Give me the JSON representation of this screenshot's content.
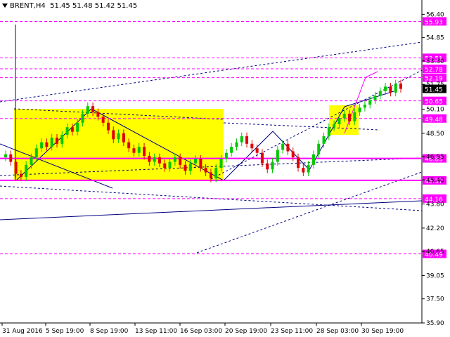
{
  "header": {
    "symbol": "BRENT,H4",
    "ohlc": "51.45 51.48 51.42 51.45"
  },
  "colors": {
    "candle_up": "#00c800",
    "candle_down": "#e00000",
    "magenta": "#ff00ff",
    "blue": "#000080",
    "yellow_box": "#ffff00",
    "price_tag": "#000000"
  },
  "chart_data": {
    "type": "candlestick",
    "ylim": [
      35.9,
      57.35
    ],
    "y_ticks": [
      "56.40",
      "54.85",
      "53.30",
      "51.75",
      "50.10",
      "48.50",
      "46.95",
      "45.40",
      "43.80",
      "42.20",
      "40.65",
      "39.05",
      "37.50",
      "35.90"
    ],
    "x_ticks": [
      "31 Aug 2016",
      "5 Sep 19:00",
      "8 Sep 19:00",
      "13 Sep 11:00",
      "16 Sep 03:00",
      "20 Sep 19:00",
      "23 Sep 11:00",
      "28 Sep 03:00",
      "30 Sep 19:00"
    ],
    "levels": [
      {
        "value": 55.93,
        "label": "55.93",
        "color": "#ff00ff"
      },
      {
        "value": 53.51,
        "label": "53.51",
        "color": "#ff00ff"
      },
      {
        "value": 52.78,
        "label": "52.78",
        "color": "#ff00ff"
      },
      {
        "value": 52.19,
        "label": "52.19",
        "color": "#ff00ff"
      },
      {
        "value": 50.65,
        "label": "50.65",
        "color": "#ff00ff"
      },
      {
        "value": 49.48,
        "label": "49.48",
        "color": "#ff00ff"
      },
      {
        "value": 46.83,
        "label": "46.83",
        "color": "#ff00ff"
      },
      {
        "value": 45.37,
        "label": "45.37",
        "color": "#ff00ff"
      },
      {
        "value": 44.16,
        "label": "44.16",
        "color": "#ff00ff"
      },
      {
        "value": 40.49,
        "label": "40.49",
        "color": "#ff00ff"
      }
    ],
    "current_price": {
      "value": 51.45,
      "label": "51.45"
    },
    "closes": [
      47.1,
      46.6,
      45.8,
      45.6,
      46.4,
      46.9,
      47.5,
      47.9,
      47.6,
      48.2,
      47.8,
      48.4,
      48.9,
      48.6,
      49.2,
      49.8,
      50.3,
      49.9,
      49.6,
      49.2,
      48.7,
      48.1,
      48.5,
      47.9,
      47.5,
      47.2,
      47.6,
      47.0,
      46.6,
      46.9,
      46.5,
      46.2,
      46.6,
      46.9,
      46.4,
      46.0,
      46.5,
      46.8,
      46.2,
      45.9,
      45.5,
      46.2,
      46.8,
      47.2,
      47.6,
      47.9,
      48.3,
      47.8,
      47.5,
      47.2,
      46.5,
      46.1,
      46.6,
      47.4,
      47.8,
      47.3,
      46.9,
      46.2,
      45.9,
      46.4,
      47.1,
      47.8,
      48.3,
      48.9,
      49.1,
      49.5,
      49.8,
      49.3,
      49.9,
      50.2,
      50.4,
      50.7,
      51.0,
      51.3,
      51.6,
      51.2,
      51.8,
      51.45
    ]
  }
}
